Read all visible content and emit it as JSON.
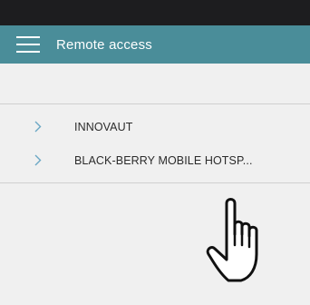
{
  "app_bar": {
    "title": "Remote access",
    "menu_icon": "hamburger-menu-icon",
    "background": "#4a8d99"
  },
  "list": {
    "items": [
      {
        "label": "INNOVAUT",
        "icon": "chevron-right-icon"
      },
      {
        "label": "BLACK-BERRY MOBILE HOTSP...",
        "icon": "chevron-right-icon"
      }
    ]
  },
  "overlay": {
    "icon": "pointing-hand-cursor-icon"
  }
}
